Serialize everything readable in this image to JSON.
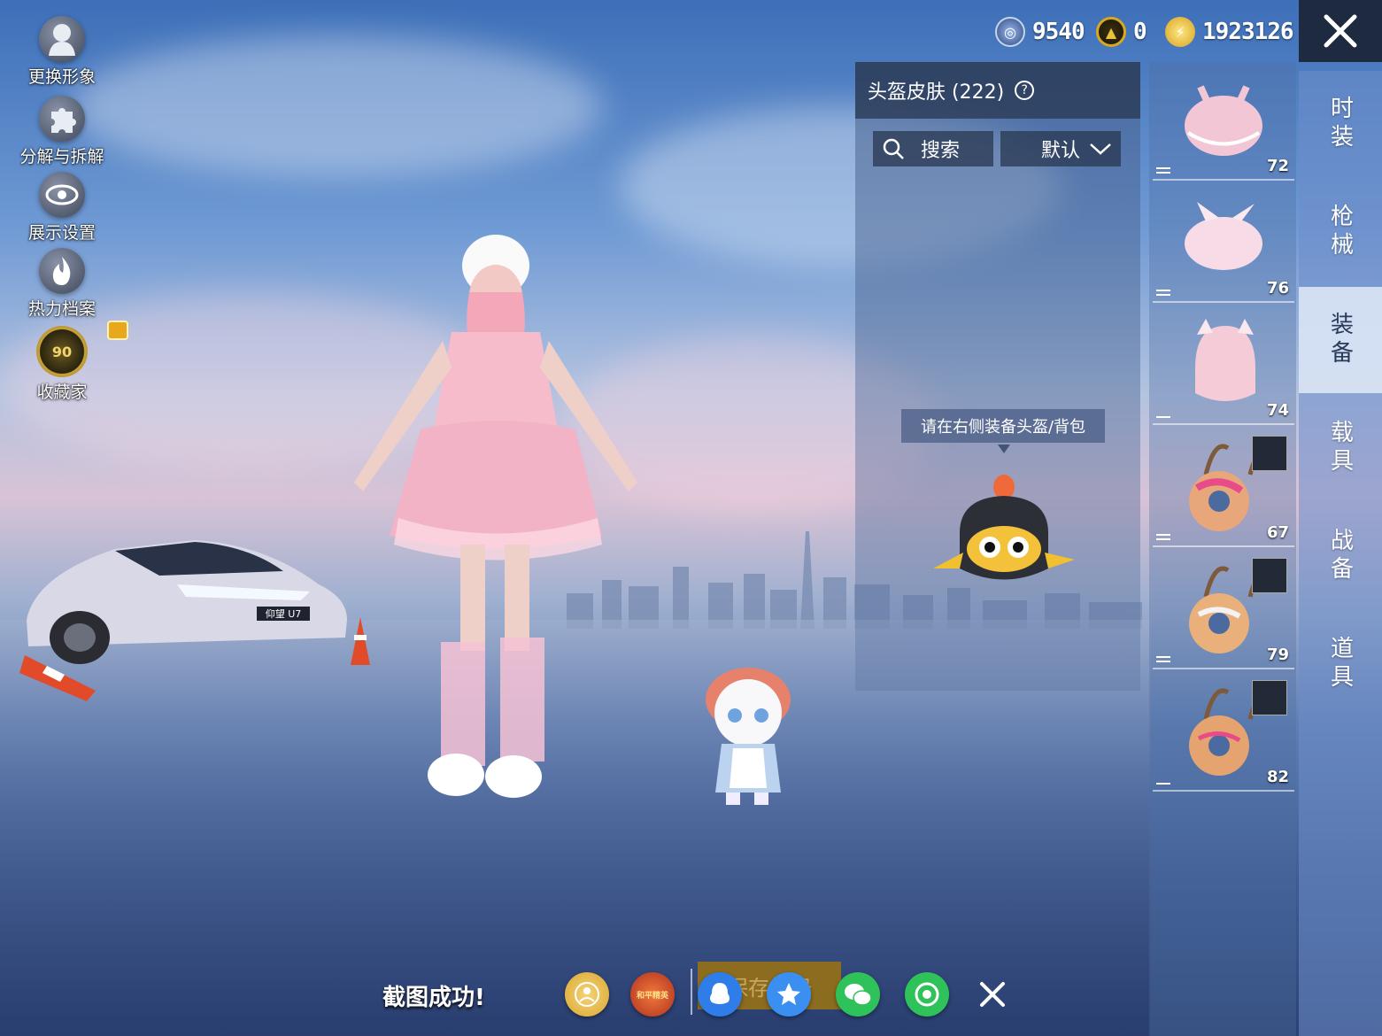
{
  "left_menu": [
    {
      "label": "更换形象",
      "icon": "person-icon"
    },
    {
      "label": "分解与拆解",
      "icon": "puzzle-icon"
    },
    {
      "label": "展示设置",
      "icon": "eye-icon"
    },
    {
      "label": "热力档案",
      "icon": "flame-icon"
    },
    {
      "label": "收藏家",
      "icon": "collector-badge-icon",
      "badge_level": "90"
    }
  ],
  "currency": [
    {
      "value": "9540",
      "icon": "coin-blue-icon",
      "color": "#4a78c8"
    },
    {
      "value": "0",
      "icon": "coin-gold-icon",
      "color": "#c99a1c"
    },
    {
      "value": "1923126",
      "icon": "lightning-coin-icon",
      "color": "#e8c23a"
    }
  ],
  "panel": {
    "title": "头盔皮肤 (222)",
    "help": "?",
    "search_label": "搜索",
    "sort_label": "默认",
    "tooltip": "请在右侧装备头盔/背包"
  },
  "car_plate": "仰望 U7",
  "items": [
    {
      "number": "72",
      "type": "helmet",
      "color": "#f3c6d6"
    },
    {
      "number": "76",
      "type": "helmet",
      "color": "#f7dbe6"
    },
    {
      "number": "74",
      "type": "helmet",
      "color": "#f5cbd8"
    },
    {
      "number": "67",
      "type": "backpack",
      "color": "#e7a77a"
    },
    {
      "number": "79",
      "type": "backpack",
      "color": "#e9b07c"
    },
    {
      "number": "82",
      "type": "backpack",
      "color": "#e5a46f"
    }
  ],
  "tabs": [
    {
      "label": "时装",
      "active": false
    },
    {
      "label": "枪械",
      "active": false
    },
    {
      "label": "装备",
      "active": true
    },
    {
      "label": "载具",
      "active": false
    },
    {
      "label": "战备",
      "active": false
    },
    {
      "label": "道具",
      "active": false
    }
  ],
  "bottom": {
    "toast": "截图成功!",
    "save_label": "保存相册",
    "badge_text": "和平精英"
  }
}
